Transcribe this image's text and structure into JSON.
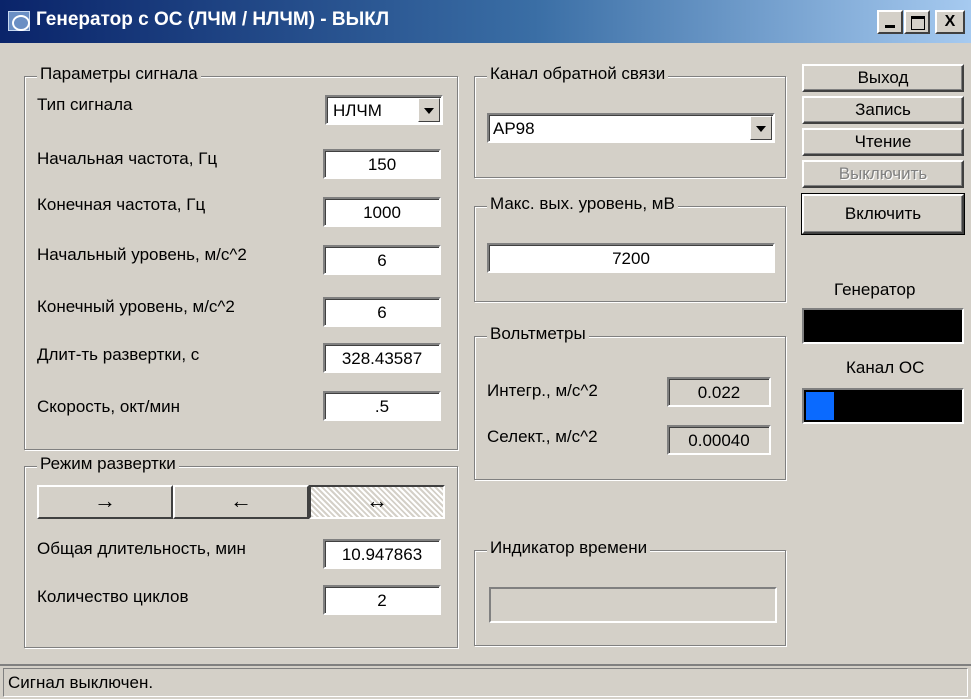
{
  "window": {
    "title": "Генератор с ОС (ЛЧМ / НЛЧМ) - ВЫКЛ",
    "min_label": "",
    "max_label": "",
    "close_label": "X"
  },
  "signal_params": {
    "legend": "Параметры сигнала",
    "type_label": "Тип сигнала",
    "type_value": "НЛЧМ",
    "start_freq_label": "Начальная частота, Гц",
    "start_freq_value": "150",
    "end_freq_label": "Конечная частота, Гц",
    "end_freq_value": "1000",
    "start_level_label": "Начальный уровень, м/с^2",
    "start_level_value": "6",
    "end_level_label": "Конечный уровень, м/с^2",
    "end_level_value": "6",
    "sweep_duration_label": "Длит-ть развертки, с",
    "sweep_duration_value": "328.43587",
    "speed_label": "Скорость, окт/мин",
    "speed_value": ".5"
  },
  "sweep_mode": {
    "legend": "Режим развертки",
    "forward_label": "→",
    "backward_label": "←",
    "both_label": "↔",
    "active": "both",
    "total_duration_label": "Общая длительность, мин",
    "total_duration_value": "10.947863",
    "cycles_label": "Количество циклов",
    "cycles_value": "2"
  },
  "feedback_channel": {
    "legend": "Канал обратной связи",
    "value": "AP98"
  },
  "max_output": {
    "legend": "Макс. вых. уровень, мВ",
    "value": "7200"
  },
  "voltmeters": {
    "legend": "Вольтметры",
    "integral_label": "Интегр., м/с^2",
    "integral_value": "0.022",
    "selective_label": "Селект., м/с^2",
    "selective_value": "0.00040"
  },
  "time_indicator": {
    "legend": "Индикатор времени",
    "progress": 0
  },
  "buttons": {
    "exit": "Выход",
    "record": "Запись",
    "read": "Чтение",
    "off": "Выключить",
    "on": "Включить"
  },
  "indicators": {
    "generator_label": "Генератор",
    "generator_level": 0,
    "channel_label": "Канал ОС",
    "channel_level": 0.18,
    "fill_color": "#0a6aff"
  },
  "statusbar": {
    "text": "Сигнал выключен."
  }
}
